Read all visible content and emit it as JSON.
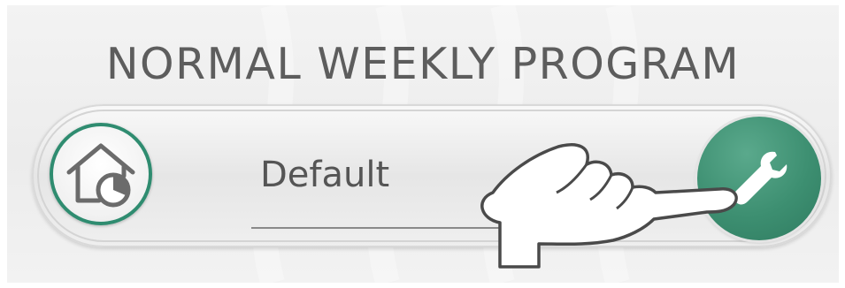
{
  "header": {
    "title": "NORMAL WEEKLY PROGRAM"
  },
  "program": {
    "name": "Default",
    "icon": "home-schedule-icon",
    "edit_icon": "wrench-icon"
  },
  "overlay": {
    "pointer_icon": "hand-pointer-icon"
  },
  "colors": {
    "accent_green": "#3d8f71",
    "title_gray": "#5d5d5d",
    "text_gray": "#555555",
    "panel_background": "#ececec"
  }
}
